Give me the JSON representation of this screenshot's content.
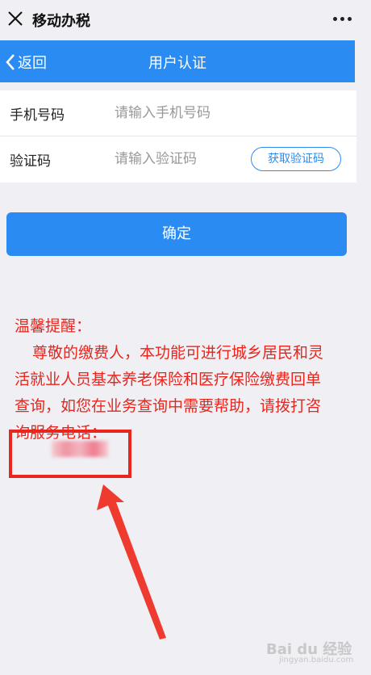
{
  "topbar": {
    "title": "移动办税"
  },
  "navbar": {
    "back_label": "返回",
    "title": "用户认证"
  },
  "form": {
    "phone": {
      "label": "手机号码",
      "placeholder": "请输入手机号码"
    },
    "code": {
      "label": "验证码",
      "placeholder": "请输入验证码",
      "button": "获取验证码"
    }
  },
  "confirm_button": "确定",
  "notice": {
    "title": "温馨提醒：",
    "body": "尊敬的缴费人，本功能可进行城乡居民和灵活就业人员基本养老保险和医疗保险缴费回单查询，如您在业务查询中需要帮助，请拨打咨询服务电话："
  },
  "watermark": {
    "text": "Bai du 经验",
    "sub": "jingyan.baidu.com"
  },
  "colors": {
    "accent": "#2a8cf2",
    "notice": "#e8261d",
    "background": "#efeff4"
  }
}
